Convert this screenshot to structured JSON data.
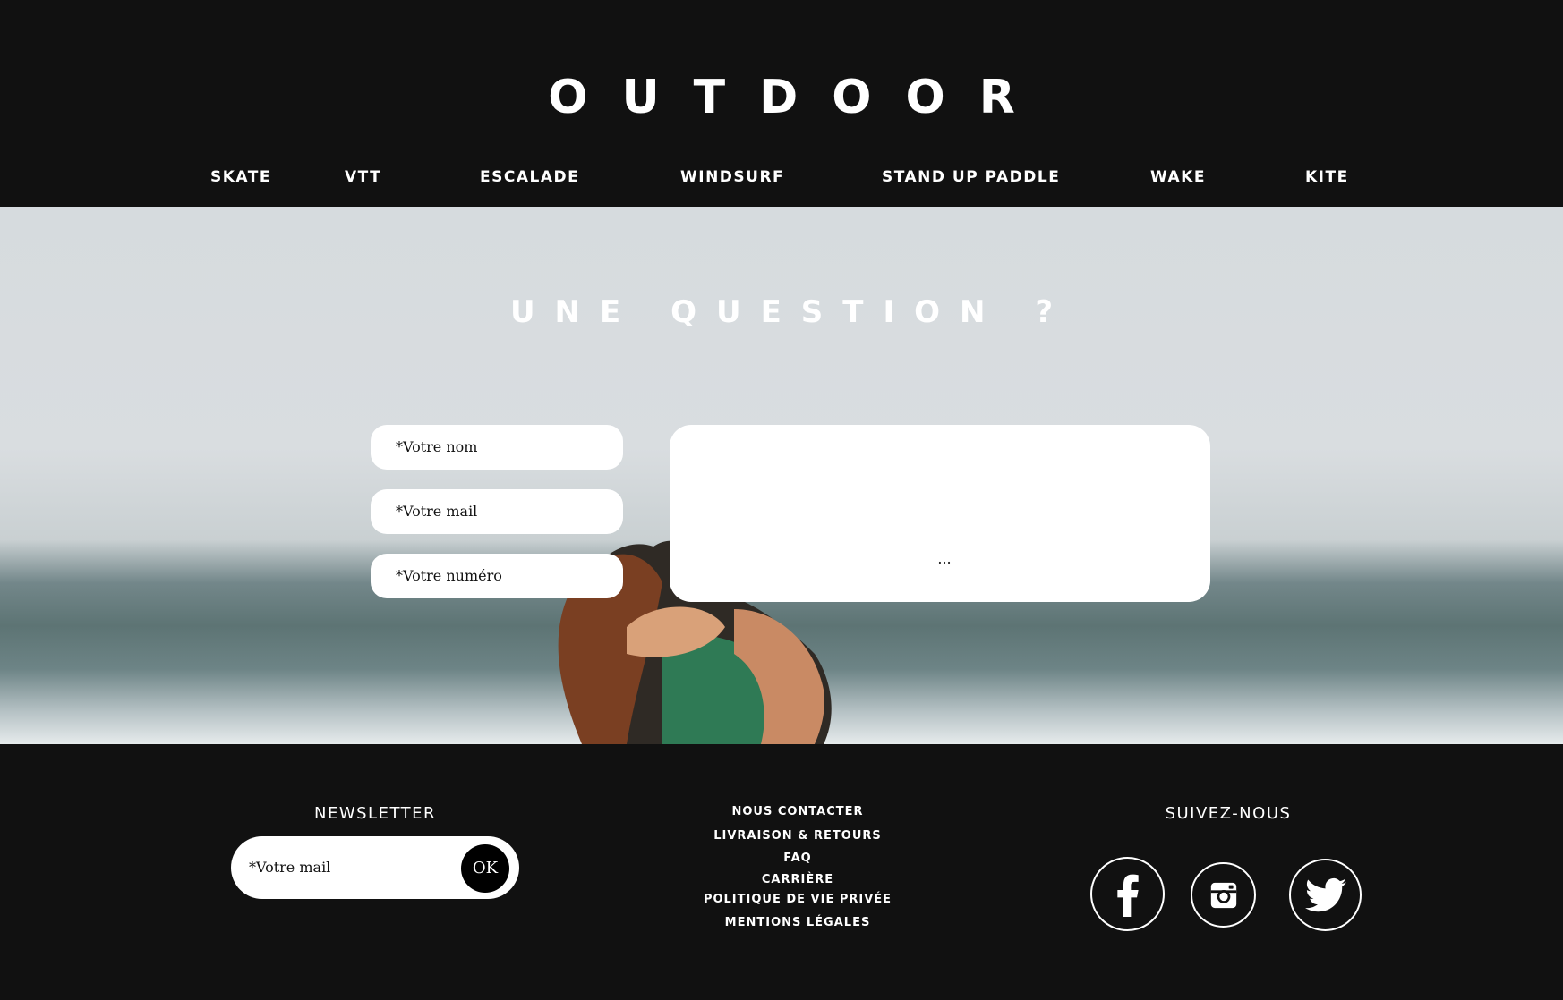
{
  "header": {
    "logo": "OUTDOOR",
    "nav": [
      {
        "label": "SKATE"
      },
      {
        "label": "VTT"
      },
      {
        "label": "ESCALADE"
      },
      {
        "label": "WINDSURF"
      },
      {
        "label": "STAND UP PADDLE"
      },
      {
        "label": "WAKE"
      },
      {
        "label": "KITE"
      }
    ]
  },
  "contact": {
    "title": "UNE QUESTION ?",
    "name_placeholder": "*Votre nom",
    "mail_placeholder": "*Votre mail",
    "phone_placeholder": "*Votre numéro",
    "message_placeholder": "..."
  },
  "footer": {
    "newsletter": {
      "title": "NEWSLETTER",
      "placeholder": "*Votre mail",
      "button": "OK"
    },
    "links": [
      {
        "label": "NOUS CONTACTER"
      },
      {
        "label": "LIVRAISON & RETOURS"
      },
      {
        "label": "FAQ"
      },
      {
        "label": "CARRIÈRE"
      },
      {
        "label": "POLITIQUE DE VIE PRIVÉE"
      },
      {
        "label": "MENTIONS LÉGALES"
      }
    ],
    "social": {
      "title": "SUIVEZ-NOUS",
      "icons": [
        "facebook-icon",
        "instagram-icon",
        "twitter-icon"
      ]
    }
  },
  "colors": {
    "background": "#111111",
    "text": "#ffffff",
    "field": "#ffffff"
  }
}
